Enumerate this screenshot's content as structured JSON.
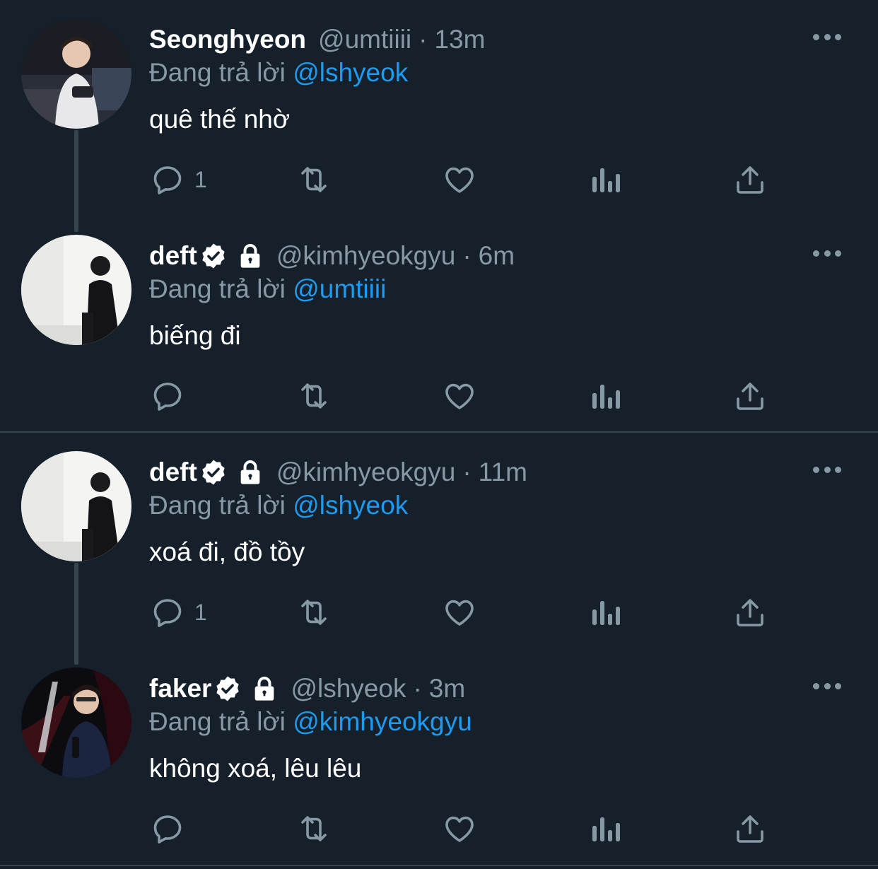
{
  "tweets": [
    {
      "name": "Seonghyeon",
      "verified": false,
      "protected": false,
      "handle": "@umtiiii",
      "separator": "·",
      "time": "13m",
      "reply_prefix": "Đang trả lời",
      "reply_to": "@lshyeok",
      "text": "quê thế nhờ",
      "reply_count": "1"
    },
    {
      "name": "deft",
      "verified": true,
      "protected": true,
      "handle": "@kimhyeokgyu",
      "separator": "·",
      "time": "6m",
      "reply_prefix": "Đang trả lời",
      "reply_to": "@umtiiii",
      "text": "biếng đi",
      "reply_count": ""
    },
    {
      "name": "deft",
      "verified": true,
      "protected": true,
      "handle": "@kimhyeokgyu",
      "separator": "·",
      "time": "11m",
      "reply_prefix": "Đang trả lời",
      "reply_to": "@lshyeok",
      "text": "xoá đi, đồ tồy",
      "reply_count": "1"
    },
    {
      "name": "faker",
      "verified": true,
      "protected": true,
      "handle": "@lshyeok",
      "separator": "·",
      "time": "3m",
      "reply_prefix": "Đang trả lời",
      "reply_to": "@kimhyeokgyu",
      "text": "không xoá, lêu lêu",
      "reply_count": ""
    }
  ],
  "icons": {
    "reply": "reply-icon",
    "retweet": "retweet-icon",
    "like": "heart-icon",
    "views": "analytics-icon",
    "share": "share-icon",
    "more": "more-icon",
    "verified": "verified-badge-icon",
    "protected": "lock-icon"
  },
  "colors": {
    "background": "#15202b",
    "mention": "#1d9bf0",
    "secondary_text": "#8899a6",
    "divider": "#38444d"
  }
}
